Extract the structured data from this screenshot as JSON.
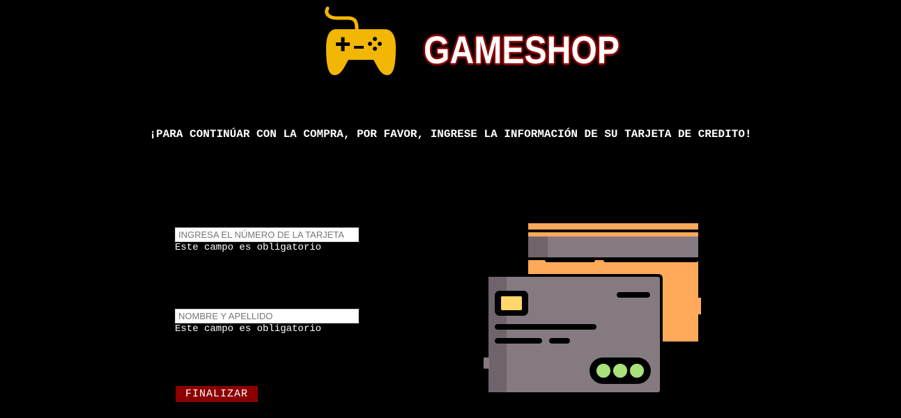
{
  "brand": {
    "name": "GAMESHOP"
  },
  "headline": "¡PARA CONTINÚAR CON LA COMPRA, POR FAVOR, INGRESE LA INFORMACIÓN DE SU TARJETA DE CREDITO!",
  "form": {
    "card_number": {
      "placeholder": "INGRESA EL NÚMERO DE LA TARJETA",
      "value": "",
      "error": "Este campo es obligatorio"
    },
    "full_name": {
      "placeholder": "NOMBRE Y APELLIDO",
      "value": "",
      "error": "Este campo es obligatorio"
    },
    "submit_label": "FINALIZAR"
  },
  "icons": {
    "logo": "gamepad-icon",
    "illustration": "credit-cards-icon"
  },
  "colors": {
    "background": "#000000",
    "accent": "#8b0000",
    "gamepad": "#f2b705",
    "card_orange": "#ffaa5a",
    "card_gray": "#857a82"
  }
}
